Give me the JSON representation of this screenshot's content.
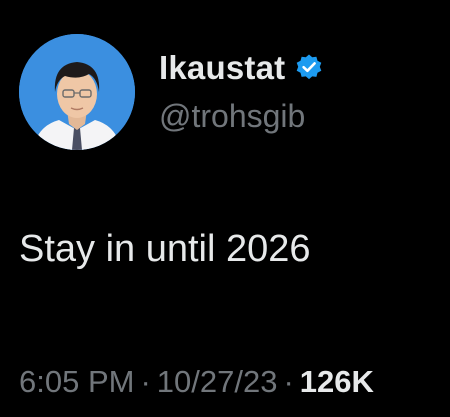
{
  "tweet": {
    "author": {
      "display_name": "Ikaustat",
      "handle": "@trohsgib",
      "verified": true,
      "avatar": "profile-photo"
    },
    "text": "Stay in until 2026",
    "time": "6:05 PM",
    "separator": "·",
    "date": "10/27/23",
    "views": "126K"
  },
  "colors": {
    "background": "#000000",
    "primary_text": "#e7e9ea",
    "secondary_text": "#71767b",
    "verified_badge": "#1d9bf0",
    "avatar_background": "#3b8fe0"
  }
}
